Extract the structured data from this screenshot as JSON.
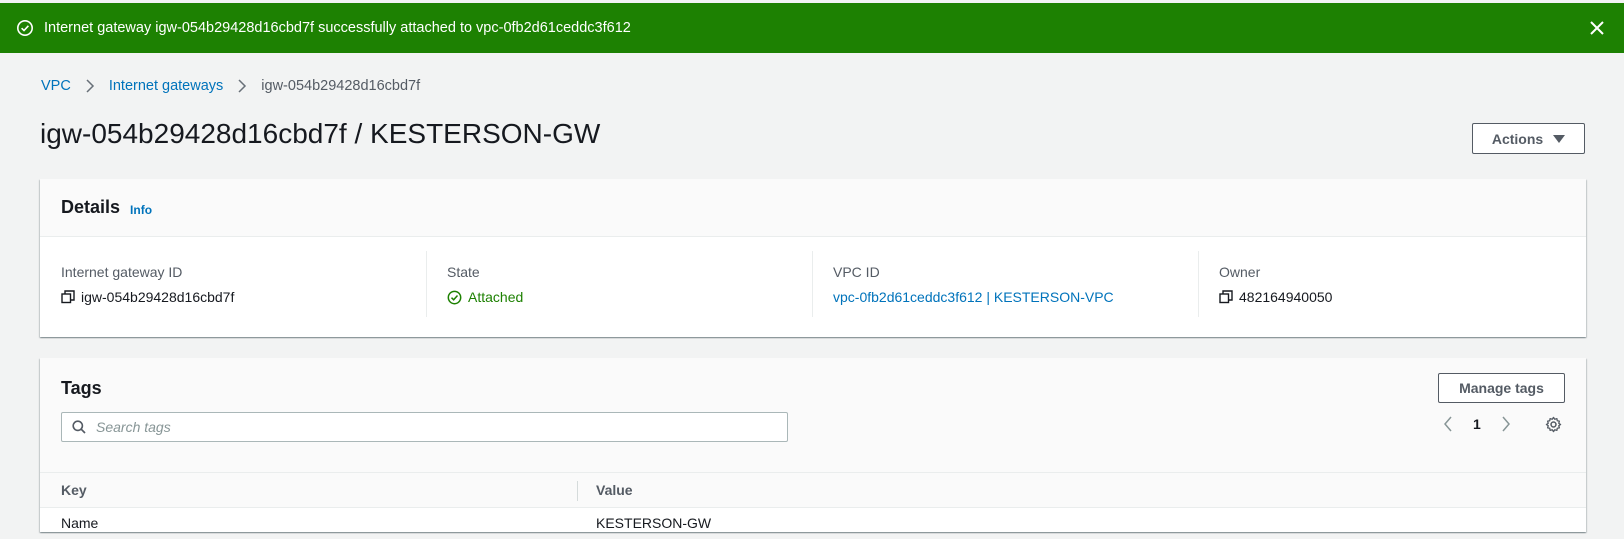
{
  "flash": {
    "message": "Internet gateway igw-054b29428d16cbd7f successfully attached to vpc-0fb2d61ceddc3f612",
    "color": "#1d8102",
    "icons": {
      "status": "check-circle-icon",
      "close": "close-icon"
    }
  },
  "breadcrumb": {
    "items": [
      "VPC",
      "Internet gateways"
    ],
    "current": "igw-054b29428d16cbd7f"
  },
  "page": {
    "title": "igw-054b29428d16cbd7f / KESTERSON-GW",
    "actions_label": "Actions"
  },
  "details": {
    "heading": "Details",
    "info_label": "Info",
    "fields": {
      "gateway_id": {
        "label": "Internet gateway ID",
        "value": "igw-054b29428d16cbd7f"
      },
      "state": {
        "label": "State",
        "value": "Attached"
      },
      "vpc_id": {
        "label": "VPC ID",
        "value": "vpc-0fb2d61ceddc3f612 | KESTERSON-VPC"
      },
      "owner": {
        "label": "Owner",
        "value": "482164940050"
      }
    }
  },
  "tags": {
    "heading": "Tags",
    "manage_label": "Manage tags",
    "search_placeholder": "Search tags",
    "page_number": "1",
    "columns": {
      "key": "Key",
      "value": "Value"
    },
    "rows": [
      {
        "key": "Name",
        "value": "KESTERSON-GW"
      }
    ]
  },
  "colors": {
    "link": "#0073bb",
    "success": "#1d8102",
    "text": "#16191f",
    "muted": "#545b64"
  }
}
